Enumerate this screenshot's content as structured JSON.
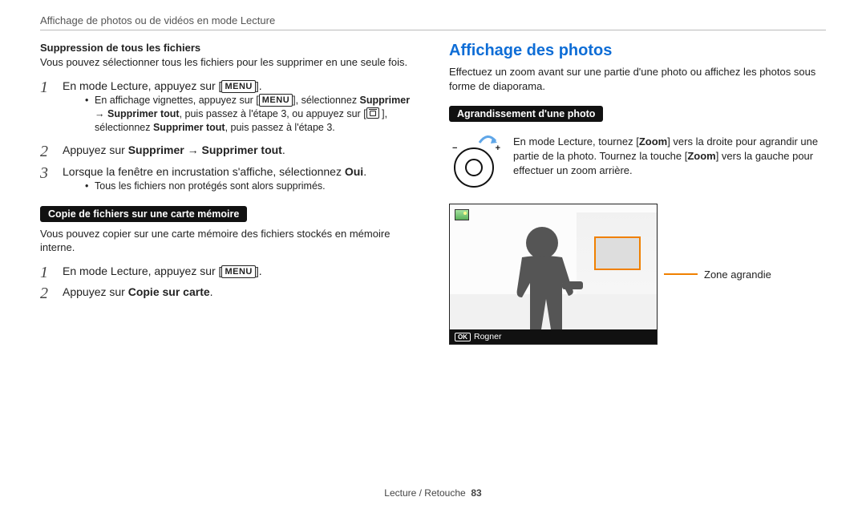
{
  "running_head": "Affichage de photos ou de vidéos en mode Lecture",
  "left": {
    "delete_all_heading": "Suppression de tous les fichiers",
    "delete_all_intro": "Vous pouvez sélectionner tous les fichiers pour les supprimer en une seule fois.",
    "menu_label": "MENU",
    "step1_prefix": "En mode Lecture, appuyez sur [",
    "step1_suffix": "].",
    "step1_bullet_a": "En affichage vignettes, appuyez sur [",
    "step1_bullet_b": "], sélectionnez ",
    "step1_bullet_supprimer": "Supprimer",
    "step1_bullet_arrow": " → ",
    "step1_bullet_supprimer_tout": "Supprimer tout",
    "step1_bullet_c": ", puis passez à l'étape 3, ou appuyez sur [",
    "step1_bullet_d": " ], sélectionnez ",
    "step1_bullet_e": ", puis passez à l'étape 3.",
    "step2_prefix": "Appuyez sur ",
    "step2_supprimer": "Supprimer",
    "step2_arrow": " → ",
    "step2_supprimer_tout": "Supprimer tout",
    "step2_suffix": ".",
    "step3_text_a": "Lorsque la fenêtre en incrustation s'affiche, sélectionnez ",
    "step3_oui": "Oui",
    "step3_suffix": ".",
    "step3_bullet": "Tous les fichiers non protégés sont alors supprimés.",
    "copy_badge": "Copie de fichiers sur une carte mémoire",
    "copy_intro": "Vous pouvez copier sur une carte mémoire des fichiers stockés en mémoire interne.",
    "copy_step2_prefix": "Appuyez sur ",
    "copy_step2_bold": "Copie sur carte",
    "copy_step2_suffix": "."
  },
  "right": {
    "h2": "Affichage des photos",
    "intro": "Effectuez un zoom avant sur une partie d'une photo ou affichez les photos sous forme de diaporama.",
    "enlarge_badge": "Agrandissement d'une photo",
    "zoom_text_a": "En mode Lecture, tournez [",
    "zoom_word": "Zoom",
    "zoom_text_b": "] vers la droite pour agrandir une partie de la photo. Tournez la touche [",
    "zoom_text_c": "] vers la gauche pour effectuer un zoom arrière.",
    "roi_label": "Zone agrandie",
    "ok_label": "OK",
    "crop_label": "Rogner"
  },
  "footer_text": "Lecture / Retouche",
  "page_number": "83"
}
